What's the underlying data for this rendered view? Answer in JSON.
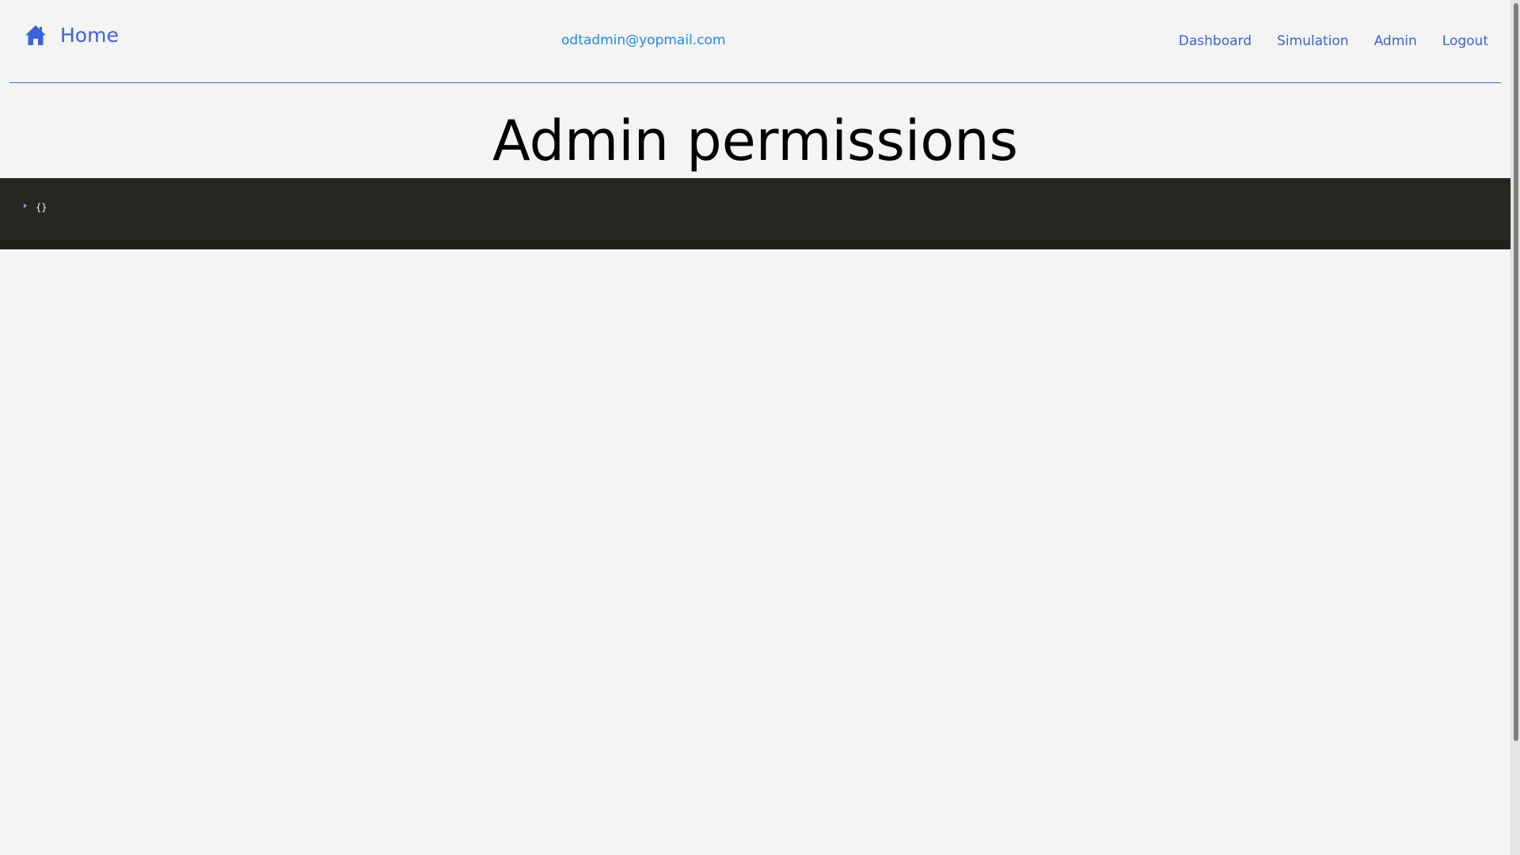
{
  "navbar": {
    "home_label": "Home",
    "home_icon": "home-icon",
    "user_email": "odtadmin@yopmail.com",
    "links": [
      {
        "label": "Dashboard"
      },
      {
        "label": "Simulation"
      },
      {
        "label": "Admin"
      },
      {
        "label": "Logout"
      }
    ]
  },
  "main": {
    "title": "Admin permissions",
    "json_viewer": {
      "content": "{}"
    }
  },
  "colors": {
    "link": "#3b62d8",
    "email": "#1e88e5",
    "json_bg": "#272822",
    "toggle": "#ae81ff"
  }
}
